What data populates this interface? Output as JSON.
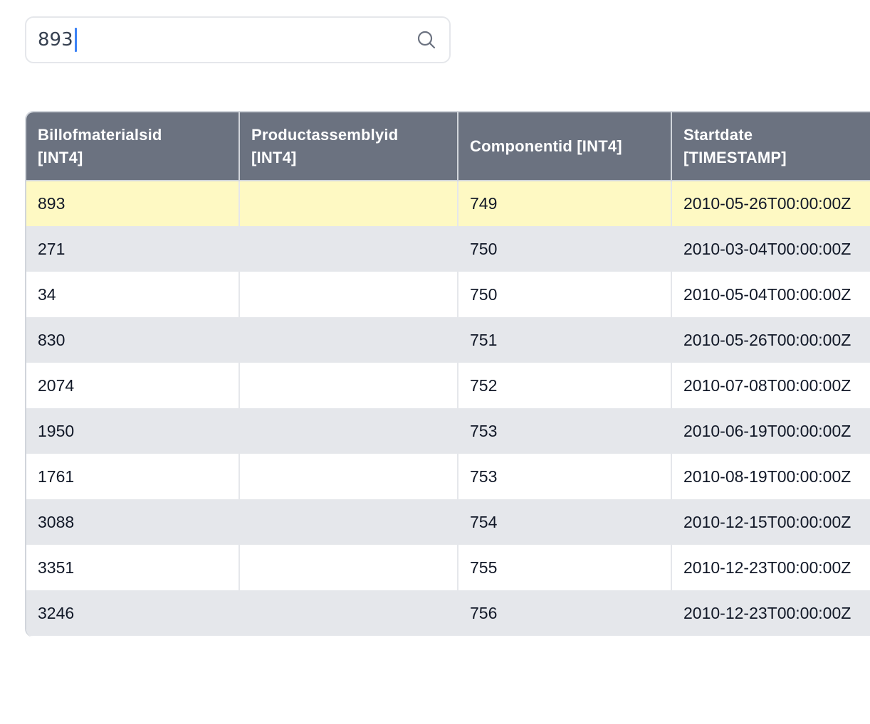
{
  "search": {
    "value": "893",
    "placeholder": ""
  },
  "table": {
    "headers": [
      {
        "line1": "Billofmaterialsid",
        "line2": "[INT4]"
      },
      {
        "line1": "Productassemblyid",
        "line2": "[INT4]"
      },
      {
        "line1": "Componentid [INT4]",
        "line2": ""
      },
      {
        "line1": "Startdate",
        "line2": "[TIMESTAMP]"
      }
    ],
    "rows": [
      {
        "billofmaterialsid": "893",
        "productassemblyid": "",
        "componentid": "749",
        "startdate": "2010-05-26T00:00:00Z"
      },
      {
        "billofmaterialsid": "271",
        "productassemblyid": "",
        "componentid": "750",
        "startdate": "2010-03-04T00:00:00Z"
      },
      {
        "billofmaterialsid": "34",
        "productassemblyid": "",
        "componentid": "750",
        "startdate": "2010-05-04T00:00:00Z"
      },
      {
        "billofmaterialsid": "830",
        "productassemblyid": "",
        "componentid": "751",
        "startdate": "2010-05-26T00:00:00Z"
      },
      {
        "billofmaterialsid": "2074",
        "productassemblyid": "",
        "componentid": "752",
        "startdate": "2010-07-08T00:00:00Z"
      },
      {
        "billofmaterialsid": "1950",
        "productassemblyid": "",
        "componentid": "753",
        "startdate": "2010-06-19T00:00:00Z"
      },
      {
        "billofmaterialsid": "1761",
        "productassemblyid": "",
        "componentid": "753",
        "startdate": "2010-08-19T00:00:00Z"
      },
      {
        "billofmaterialsid": "3088",
        "productassemblyid": "",
        "componentid": "754",
        "startdate": "2010-12-15T00:00:00Z"
      },
      {
        "billofmaterialsid": "3351",
        "productassemblyid": "",
        "componentid": "755",
        "startdate": "2010-12-23T00:00:00Z"
      },
      {
        "billofmaterialsid": "3246",
        "productassemblyid": "",
        "componentid": "756",
        "startdate": "2010-12-23T00:00:00Z"
      }
    ],
    "highlighted_row_index": 0
  },
  "colors": {
    "header_bg": "#6b7280",
    "highlight": "#fef9c3",
    "stripe": "#e5e7eb",
    "caret": "#3b82f6"
  }
}
